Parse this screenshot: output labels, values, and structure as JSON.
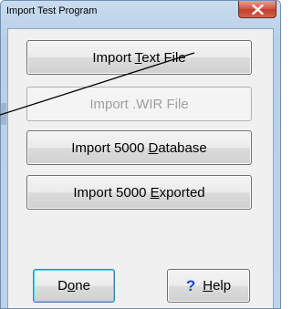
{
  "window": {
    "title": "Import Test Program"
  },
  "buttons": {
    "import_text": {
      "pre": "Import ",
      "key": "T",
      "post": "ext File"
    },
    "import_wir": {
      "label": "Import .WIR File"
    },
    "import_database": {
      "pre": "Import 5000 ",
      "key": "D",
      "post": "atabase"
    },
    "import_exported": {
      "pre": "Import 5000 ",
      "key": "E",
      "post": "xported"
    },
    "done": {
      "pre": "D",
      "key": "o",
      "post": "ne"
    },
    "help": {
      "icon_glyph": "?",
      "pre": "",
      "key": "H",
      "post": "elp"
    }
  },
  "icons": {
    "close": "close-icon",
    "help": "question-mark-icon"
  },
  "colors": {
    "close_button": "#c13f2b",
    "help_icon": "#1847d6",
    "disabled_text": "#a0a0a0"
  }
}
